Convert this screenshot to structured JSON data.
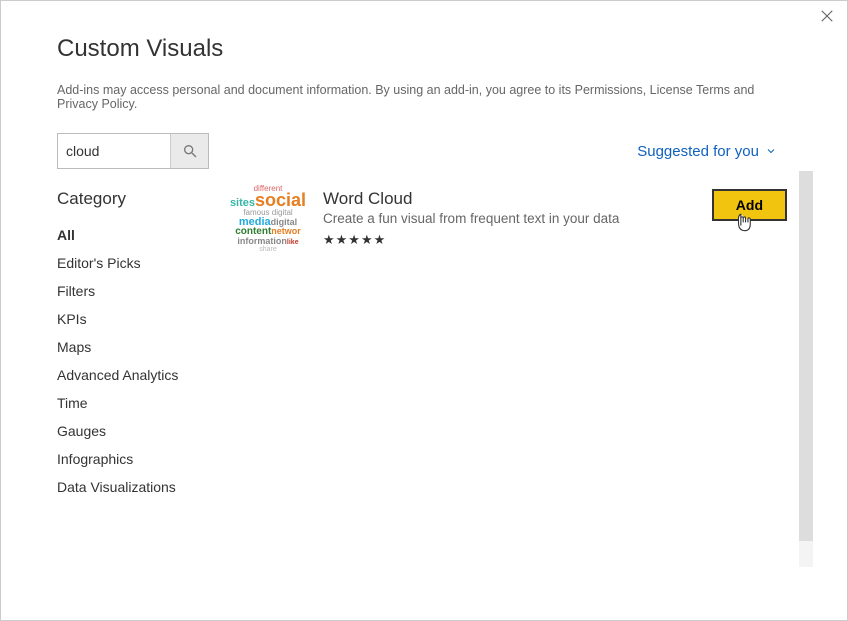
{
  "dialog": {
    "title": "Custom Visuals",
    "disclaimer": "Add-ins may access personal and document information. By using an add-in, you agree to its Permissions, License Terms and Privacy Policy."
  },
  "search": {
    "value": "cloud",
    "placeholder": "Search"
  },
  "suggested_link": "Suggested for you",
  "category": {
    "header": "Category",
    "items": [
      "All",
      "Editor's Picks",
      "Filters",
      "KPIs",
      "Maps",
      "Advanced Analytics",
      "Time",
      "Gauges",
      "Infographics",
      "Data Visualizations"
    ],
    "active_index": 0
  },
  "results": [
    {
      "title": "Word Cloud",
      "description": "Create a fun visual from frequent text in your data",
      "rating": 5,
      "add_label": "Add"
    }
  ],
  "thumb_words": {
    "different": "different",
    "sites": "sites",
    "social": "social",
    "famous": "famous",
    "digital": "digital",
    "media": "media",
    "content": "content",
    "networ": "networ",
    "information": "information",
    "like": "like",
    "share": "share"
  }
}
